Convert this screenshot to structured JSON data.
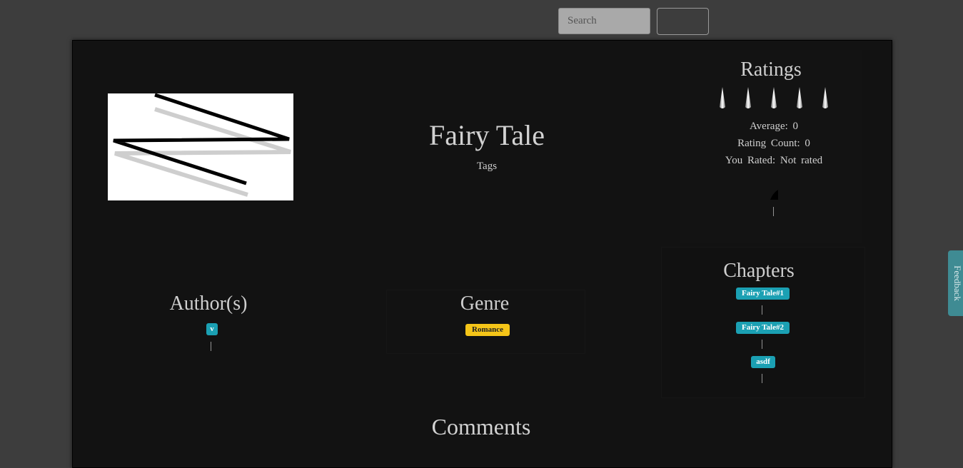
{
  "search": {
    "placeholder": "Search",
    "button_label": ""
  },
  "story": {
    "title": "Fairy Tale",
    "tags_label": "Tags"
  },
  "ratings": {
    "heading": "Ratings",
    "star_count": 5,
    "average": "Average:  0",
    "rating_count": "Rating  Count:  0",
    "you_rated": "You Rated:  Not  rated"
  },
  "authors": {
    "heading": "Author(s)",
    "items": [
      "v"
    ]
  },
  "genre": {
    "heading": "Genre",
    "items": [
      "Romance"
    ]
  },
  "chapters": {
    "heading": "Chapters",
    "items": [
      "Fairy Tale#1",
      "Fairy Tale#2",
      "asdf"
    ]
  },
  "comments": {
    "heading": "Comments"
  },
  "feedback": {
    "label": "Feedback"
  },
  "colors": {
    "page_bg": "#3d3d3d",
    "panel_bg": "#121212",
    "badge_teal": "#1ba0b3",
    "badge_yellow": "#f5c518",
    "feedback_tab": "#3f8b93"
  }
}
